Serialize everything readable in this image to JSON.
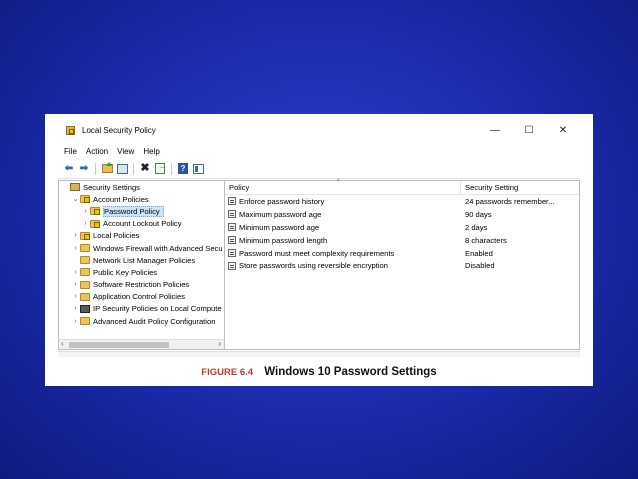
{
  "window": {
    "title": "Local Security Policy",
    "controls": {
      "minimize": "—",
      "maximize": "☐",
      "close": "✕"
    }
  },
  "menu": [
    "File",
    "Action",
    "View",
    "Help"
  ],
  "toolbar": {
    "icons": [
      "back-arrow-icon",
      "forward-arrow-icon",
      "up-folder-icon",
      "show-console-tree-icon",
      "delete-icon",
      "export-list-icon",
      "help-icon",
      "view-icon"
    ],
    "back": "⬅",
    "forward": "➡",
    "delete": "✖",
    "help": "?"
  },
  "tree": {
    "items": [
      {
        "label": "Security Settings",
        "chevron": "",
        "icon": "book",
        "indent": 0
      },
      {
        "label": "Account Policies",
        "chevron": "⌄",
        "icon": "folder-lock",
        "indent": 1
      },
      {
        "label": "Password Policy",
        "chevron": "›",
        "icon": "folder-lock",
        "indent": 2,
        "selected": true
      },
      {
        "label": "Account Lockout Policy",
        "chevron": "›",
        "icon": "folder-lock",
        "indent": 2
      },
      {
        "label": "Local Policies",
        "chevron": "›",
        "icon": "folder-lock",
        "indent": 1
      },
      {
        "label": "Windows Firewall with Advanced Secu",
        "chevron": "›",
        "icon": "folder",
        "indent": 1
      },
      {
        "label": "Network List Manager Policies",
        "chevron": "",
        "icon": "folder",
        "indent": 1
      },
      {
        "label": "Public Key Policies",
        "chevron": "›",
        "icon": "folder",
        "indent": 1
      },
      {
        "label": "Software Restriction Policies",
        "chevron": "›",
        "icon": "folder",
        "indent": 1
      },
      {
        "label": "Application Control Policies",
        "chevron": "›",
        "icon": "folder",
        "indent": 1
      },
      {
        "label": "IP Security Policies on Local Compute",
        "chevron": "›",
        "icon": "ipsec",
        "indent": 1
      },
      {
        "label": "Advanced Audit Policy Configuration",
        "chevron": "›",
        "icon": "folder",
        "indent": 1
      }
    ],
    "scroll_left": "‹",
    "scroll_right": "›"
  },
  "list": {
    "columns": {
      "policy": "Policy",
      "setting": "Security Setting",
      "sort_indicator": "^"
    },
    "rows": [
      {
        "policy": "Enforce password history",
        "setting": "24 passwords remember..."
      },
      {
        "policy": "Maximum password age",
        "setting": "90 days"
      },
      {
        "policy": "Minimum password age",
        "setting": "2 days"
      },
      {
        "policy": "Minimum password length",
        "setting": "8 characters"
      },
      {
        "policy": "Password must meet complexity requirements",
        "setting": "Enabled"
      },
      {
        "policy": "Store passwords using reversible encryption",
        "setting": "Disabled"
      }
    ]
  },
  "caption": {
    "figure": "FIGURE 6.4",
    "text": "Windows 10 Password Settings"
  },
  "colors": {
    "background": "#1a2aa8",
    "figure_label": "#c0392b",
    "selection": "#cce4f7"
  }
}
